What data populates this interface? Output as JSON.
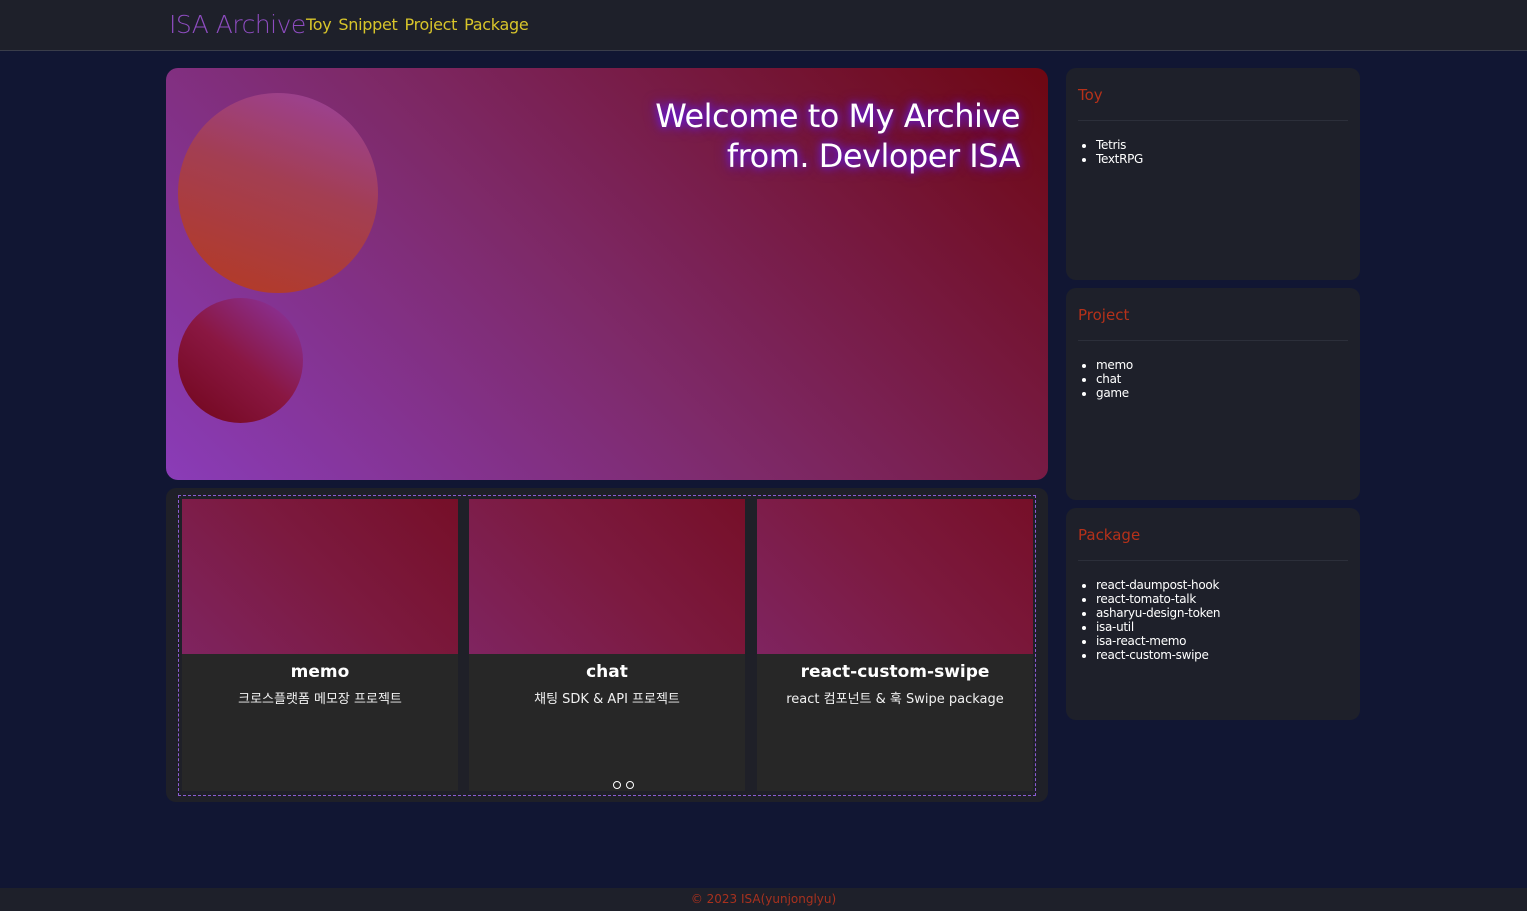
{
  "header": {
    "logo": "ISA Archive",
    "nav": [
      "Toy",
      "Snippet",
      "Project",
      "Package"
    ]
  },
  "hero": {
    "title_line1": "Welcome to My Archive",
    "title_line2": "from. Devloper ISA"
  },
  "carousel": {
    "cards": [
      {
        "title": "memo",
        "desc": "크로스플랫폼 메모장 프로젝트"
      },
      {
        "title": "chat",
        "desc": "채팅 SDK & API 프로젝트"
      },
      {
        "title": "react-custom-swipe",
        "desc": "react 컴포넌트 & 훅 Swipe package"
      }
    ],
    "dot_count": 2
  },
  "sidebar": {
    "sections": [
      {
        "title": "Toy",
        "items": [
          "Tetris",
          "TextRPG"
        ]
      },
      {
        "title": "Project",
        "items": [
          "memo",
          "chat",
          "game"
        ]
      },
      {
        "title": "Package",
        "items": [
          "react-daumpost-hook",
          "react-tomato-talk",
          "asharyu-design-token",
          "isa-util",
          "isa-react-memo",
          "react-custom-swipe"
        ]
      }
    ]
  },
  "footer": {
    "copyright": "© 2023 ISA(yunjonglyu)"
  },
  "colors": {
    "background": "#111633",
    "logo": "#8e4cc0",
    "nav": "#d8c52a",
    "section_title": "#b5311a",
    "footer_text": "#a8311e"
  }
}
